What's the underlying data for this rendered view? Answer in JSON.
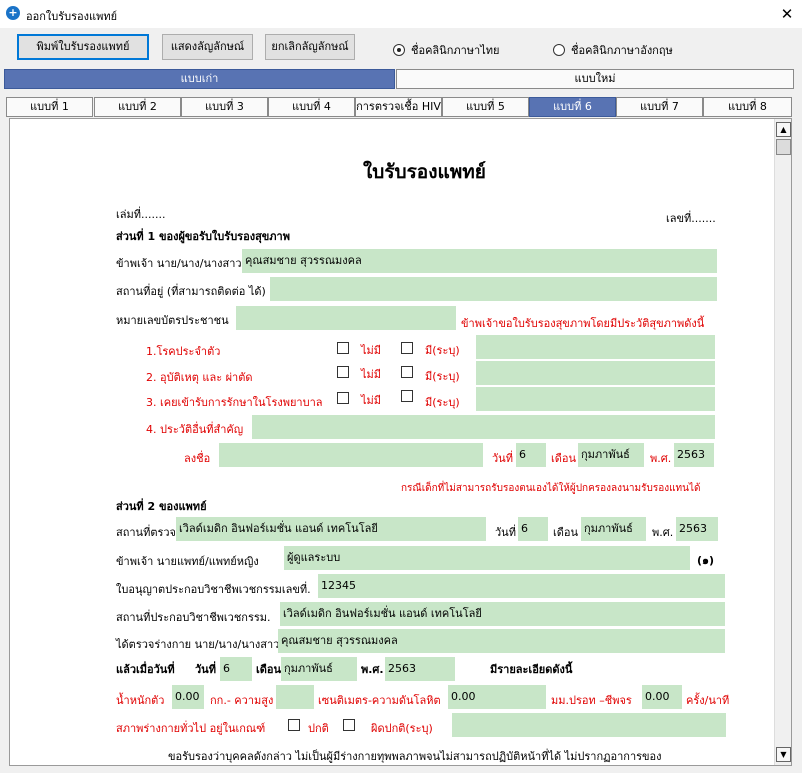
{
  "window": {
    "title": "ออกใบรับรองแพทย์",
    "icon": "app-icon",
    "close": "✕"
  },
  "toolbar": {
    "print_label": "พิมพ์ใบรับรองแพทย์",
    "show_sig_label": "แสดงลัญลักษณ์",
    "cancel_sig_label": "ยกเลิกลัญลักษณ์",
    "radio_thai_label": "ชื่อคลินิกภาษาไทย",
    "radio_eng_label": "ชื่อคลินิกภาษาอังกฤษ",
    "radio_selected": "thai"
  },
  "mode_tabs": [
    {
      "label": "แบบเก่า",
      "active": true
    },
    {
      "label": "แบบใหม่",
      "active": false
    }
  ],
  "form_tabs": [
    {
      "label": "แบบที่ 1"
    },
    {
      "label": "แบบที่ 2"
    },
    {
      "label": "แบบที่ 3"
    },
    {
      "label": "แบบที่ 4"
    },
    {
      "label": "การตรวจเชื้อ HIV"
    },
    {
      "label": "แบบที่ 5"
    },
    {
      "label": "แบบที่ 6",
      "active": true
    },
    {
      "label": "แบบที่ 7"
    },
    {
      "label": "แบบที่ 8"
    }
  ],
  "doc": {
    "title": "ใบรับรองแพทย์",
    "book_no": "เล่มที่.......",
    "no": "เลขที่.......",
    "section1": "ส่วนที่ 1 ของผู้ขอรับใบรับรองสุขภาพ",
    "name_label": "ข้าพเจ้า นาย/นาง/นางสาว",
    "name_value": "คุณสมชาย สุวรรณมงคล",
    "address_label": "สถานที่อยู่ (ที่สามารถติดต่อ ได้)",
    "address_value": "",
    "id_label": "หมายเลขบัตรประชาชน",
    "id_value": "",
    "request_text": "ข้าพเจ้าขอใบรับรองสุขภาพโดยมีประวัติสุขภาพดังนี้",
    "history": [
      {
        "label": "1.โรคประจำตัว",
        "no": "ไม่มี",
        "yes": "มี(ระบุ)",
        "value": ""
      },
      {
        "label": "2. อุบัติเหตุ และ ผ่าตัด",
        "no": "ไม่มี",
        "yes": "มี(ระบุ)",
        "value": ""
      },
      {
        "label": "3. เคยเข้ารับการรักษาในโรงพยาบาล",
        "no": "ไม่มี",
        "yes": "มี(ระบุ)",
        "value": ""
      }
    ],
    "other_history_label": "4. ประวัติอื่นที่สำคัญ",
    "other_history_value": "",
    "sign_label": "ลงชื่อ",
    "sign_value": "",
    "day_label": "วันที่",
    "day_value": "6",
    "month_label": "เดือน",
    "month_value": "กุมภาพันธ์",
    "year_label": "พ.ศ.",
    "year_value": "2563",
    "guardian_note": "กรณีเด็กที่ไม่สามารถรับรองตนเองได้ให้ผู้ปกครองลงนามรับรองแทนได้",
    "section2": "ส่วนที่ 2 ของแพทย์",
    "exam_place_label": "สถานที่ตรวจ",
    "exam_place_value": "เวิลด์เมดิก อินฟอร์เมชั่น แอนด์ เทคโนโลยี",
    "s2_day_label": "วันที่",
    "s2_day_value": "6",
    "s2_month_label": "เดือน",
    "s2_month_value": "กุมภาพันธ์",
    "s2_year_label": "พ.ศ.",
    "s2_year_value": "2563",
    "doctor_label": "ข้าพเจ้า นายแพทย์/แพทย์หญิง",
    "doctor_value": "ผู้ดูแลระบบ",
    "doctor_suffix": "(๑)",
    "license_label": "ใบอนุญาตประกอบวิชาชีพเวชกรรมเลขที่.",
    "license_value": "12345",
    "practice_label": "สถานที่ประกอบวิชาชีพเวชกรรม.",
    "practice_value": "เวิลด์เมดิก อินฟอร์เมชั่น แอนด์ เทคโนโลยี",
    "examined_label": "ได้ตรวจร่างกาย นาย/นาง/นางสาว",
    "examined_value": "คุณสมชาย สุวรรณมงคล",
    "when_label": "แล้วเมื่อวันที่",
    "when_day_label": "วันที่",
    "when_day_value": "6",
    "when_month_label": "เดือน",
    "when_month_value": "กุมภาพันธ์",
    "when_year_label": "พ.ศ.",
    "when_year_value": "2563",
    "details_label": "มีรายละเอียดดังนี้",
    "weight_label": "น้ำหนักตัว",
    "weight_value": "0.00",
    "kg_height_label": "กก.- ความสูง",
    "height_value": "",
    "cm_bp_label": "เซนติเมตร-ความดันโลหิต",
    "bp_value": "0.00",
    "mmhg_pulse_label": "มม.ปรอท –ชีพจร",
    "pulse_value": "0.00",
    "per_min_label": "ครั้ง/นาที",
    "general_label": "สภาพร่างกายทั่วไป อยู่ในเกณฑ์",
    "normal_label": "ปกติ",
    "abnormal_label": "ผิดปกติ(ระบุ)",
    "general_value": "",
    "closing_text": "ขอรับรองว่าบุคคลดังกล่าว ไม่เป็นผู้มีร่างกายทุพพลภาพจนไม่สามารถปฏิบัติหน้าที่ได้ ไม่ปรากฏอาการของ"
  },
  "colors": {
    "field_bg": "#c8e6c8",
    "tab_active": "#5873b3",
    "red_text": "#e00000"
  }
}
